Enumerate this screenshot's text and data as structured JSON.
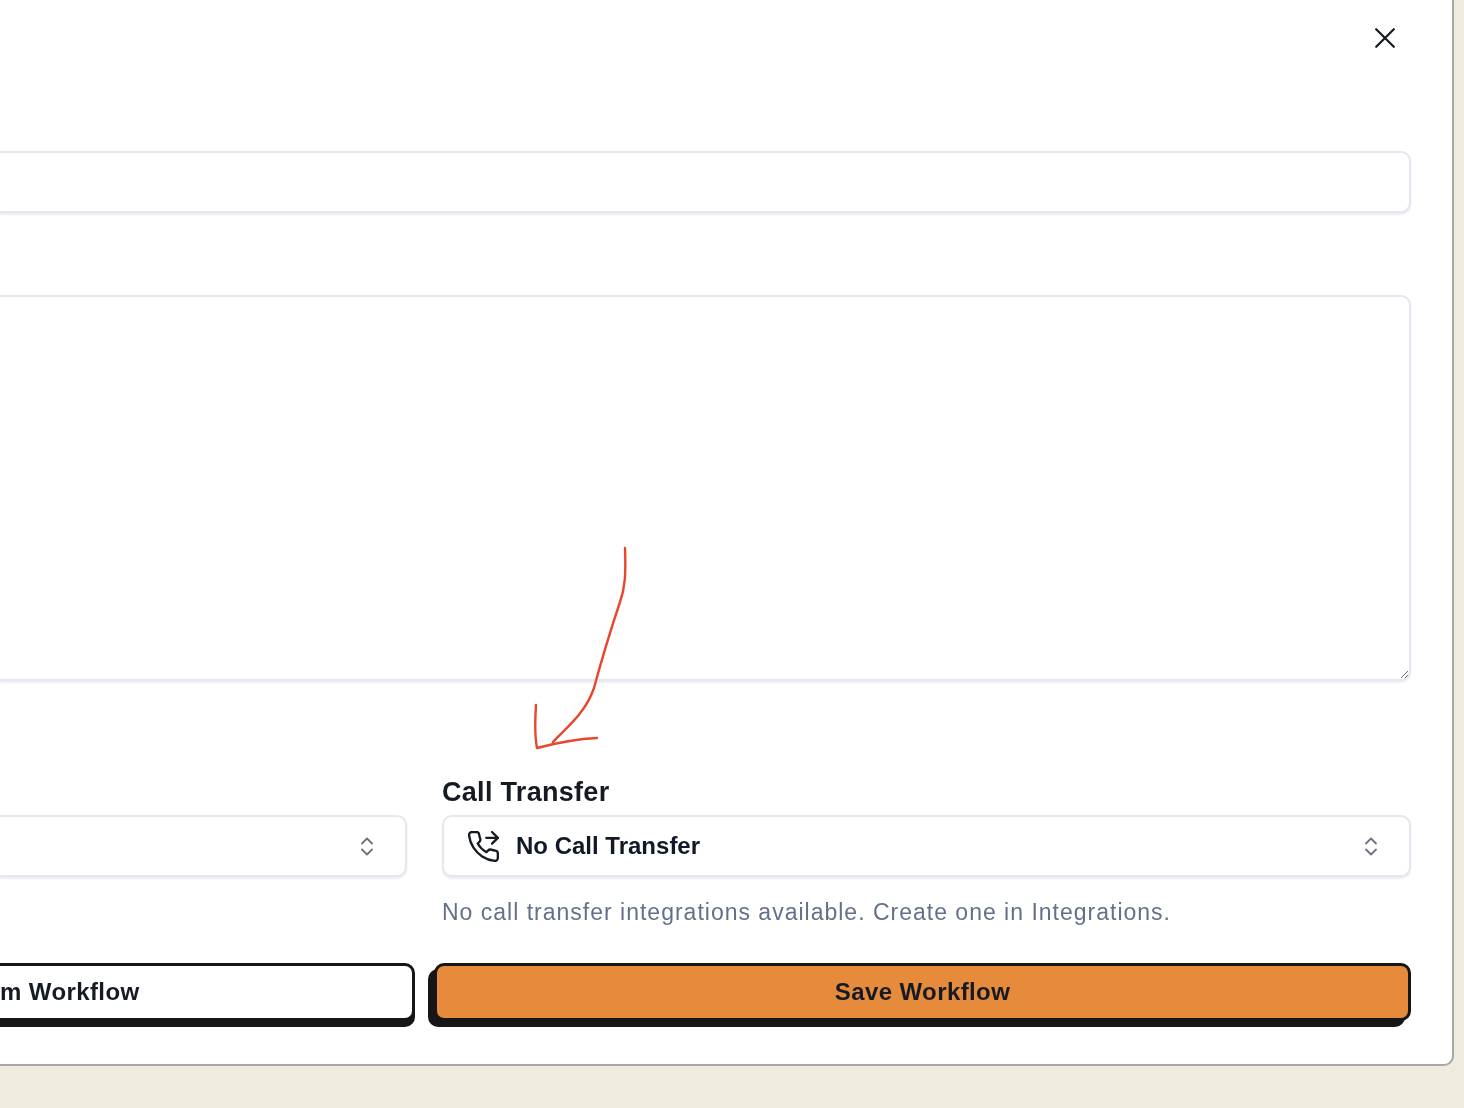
{
  "fields": [
    {
      "kind": "text"
    },
    {
      "kind": "textarea"
    }
  ],
  "selects": [
    {
      "kind": "plain"
    },
    {
      "kind": "call_transfer",
      "label": "Call Transfer",
      "value": "No Call Transfer",
      "help": "No call transfer integrations available. Create one in Integrations."
    }
  ],
  "buttons": [
    {
      "kind": "secondary",
      "label": "m Workflow"
    },
    {
      "kind": "primary",
      "label": "Save Workflow"
    }
  ]
}
